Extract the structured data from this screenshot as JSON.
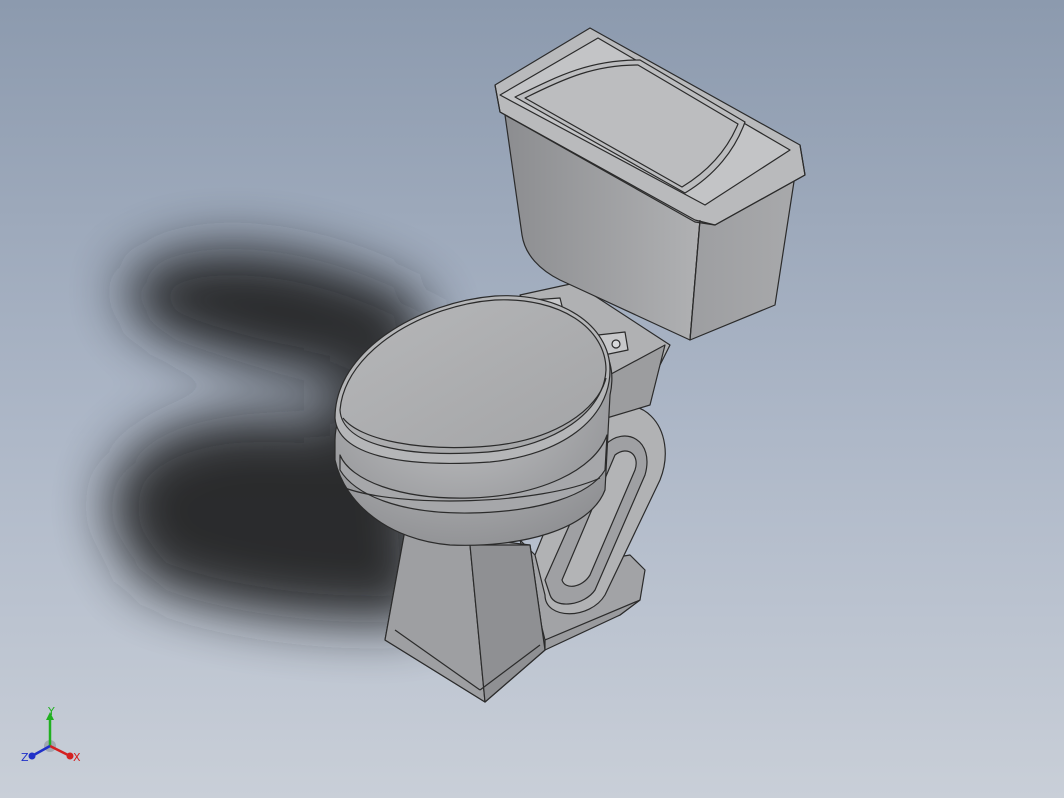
{
  "viewport": {
    "background_top": "#8c9aae",
    "background_bottom": "#c9cfd8"
  },
  "model": {
    "icon": "toilet-model",
    "body_color": "#a9aaac",
    "edge_color": "#2b2b2b"
  },
  "triad": {
    "x_label": "X",
    "y_label": "Y",
    "z_label": "Z",
    "x_color": "#d42020",
    "y_color": "#20b020",
    "z_color": "#2030c8"
  }
}
